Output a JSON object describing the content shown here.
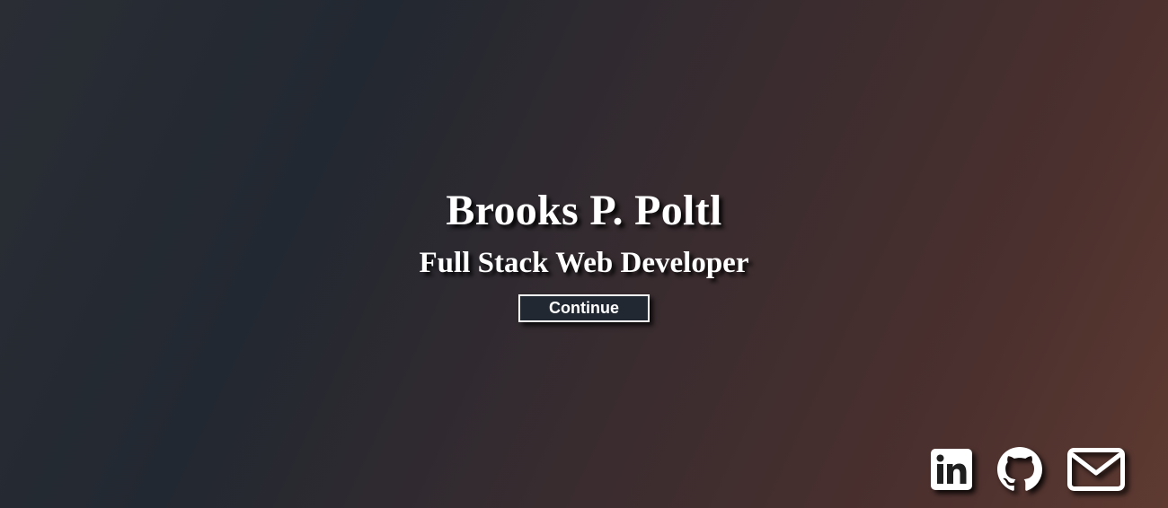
{
  "hero": {
    "name": "Brooks P. Poltl",
    "role": "Full Stack Web Developer",
    "continue_label": "Continue"
  },
  "social": [
    {
      "icon": "linkedin-icon",
      "label": "LinkedIn"
    },
    {
      "icon": "github-icon",
      "label": "GitHub"
    },
    {
      "icon": "envelope-icon",
      "label": "Email"
    }
  ],
  "colors": {
    "gradient_start": "#222831",
    "gradient_end": "#5e3a31",
    "text": "#ffffff",
    "button_bg": "#222831"
  }
}
